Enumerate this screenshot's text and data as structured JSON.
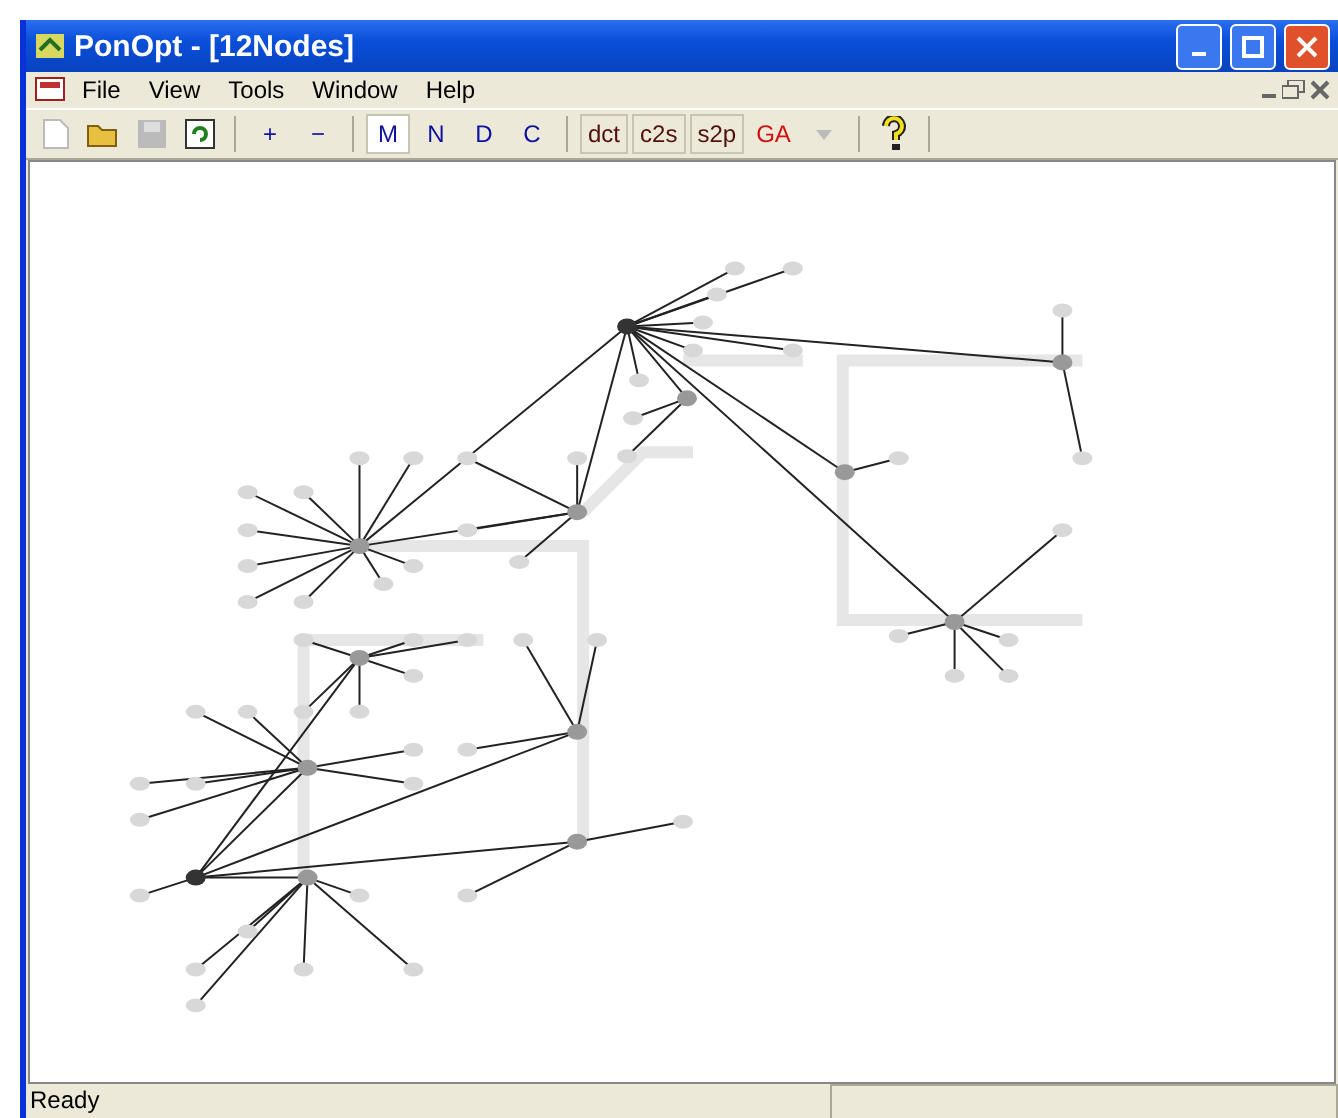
{
  "window": {
    "title": "PonOpt - [12Nodes]"
  },
  "menu": [
    "File",
    "View",
    "Tools",
    "Window",
    "Help"
  ],
  "toolbar": {
    "zoom": [
      "+",
      "−"
    ],
    "modes": [
      {
        "label": "M",
        "selected": true
      },
      {
        "label": "N",
        "selected": false
      },
      {
        "label": "D",
        "selected": false
      },
      {
        "label": "C",
        "selected": false
      }
    ],
    "tools": [
      {
        "label": "dct",
        "kind": "boxed"
      },
      {
        "label": "c2s",
        "kind": "boxed"
      },
      {
        "label": "s2p",
        "kind": "boxed"
      },
      {
        "label": "GA",
        "kind": "accent"
      }
    ]
  },
  "status_bar": {
    "text": "Ready"
  }
}
